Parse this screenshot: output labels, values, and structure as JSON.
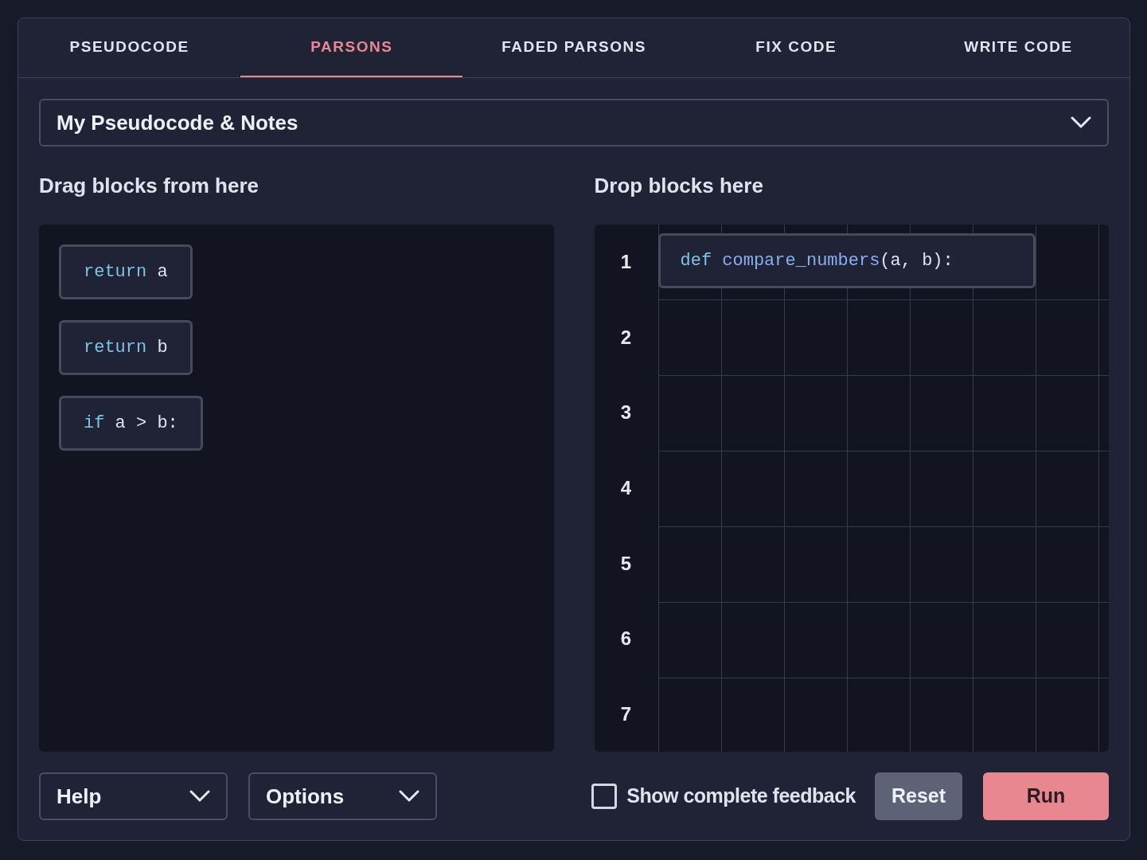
{
  "tabs": [
    {
      "label": "PSEUDOCODE",
      "selected": false
    },
    {
      "label": "PARSONS",
      "selected": true
    },
    {
      "label": "FADED PARSONS",
      "selected": false
    },
    {
      "label": "FIX CODE",
      "selected": false
    },
    {
      "label": "WRITE CODE",
      "selected": false
    }
  ],
  "notes_dropdown": {
    "label": "My Pseudocode & Notes"
  },
  "source": {
    "heading": "Drag blocks from here",
    "blocks": [
      {
        "tokens": [
          {
            "kind": "keyword",
            "text": "return"
          },
          {
            "kind": "plain",
            "text": " a"
          }
        ]
      },
      {
        "tokens": [
          {
            "kind": "keyword",
            "text": "return"
          },
          {
            "kind": "plain",
            "text": " b"
          }
        ]
      },
      {
        "tokens": [
          {
            "kind": "keyword",
            "text": "if"
          },
          {
            "kind": "plain",
            "text": " a > b:"
          }
        ]
      }
    ]
  },
  "target": {
    "heading": "Drop blocks here",
    "line_numbers": [
      "1",
      "2",
      "3",
      "4",
      "5",
      "6",
      "7"
    ],
    "placed_blocks": [
      {
        "tokens": [
          {
            "kind": "keyword",
            "text": "def"
          },
          {
            "kind": "function",
            "text": " compare_numbers"
          },
          {
            "kind": "plain",
            "text": "(a, b):"
          }
        ]
      }
    ]
  },
  "footer": {
    "help": "Help",
    "options": "Options",
    "feedback": {
      "label": "Show complete feedback",
      "checked": false
    },
    "reset": "Reset",
    "run": "Run"
  }
}
